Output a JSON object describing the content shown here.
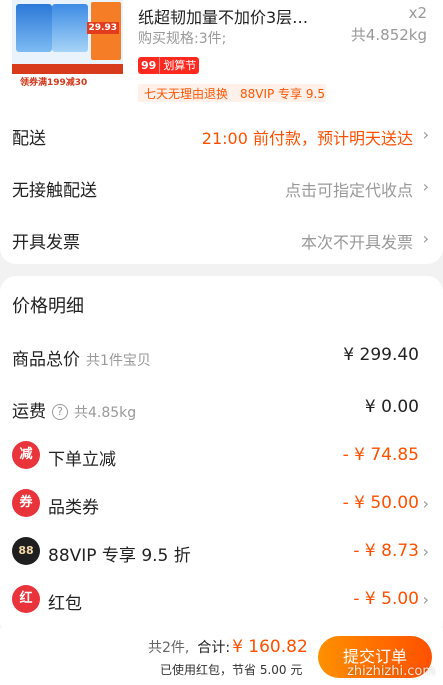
{
  "product": {
    "title": "纸超韧加量不加价3层…",
    "qty": "x2",
    "spec": "购买规格:3件;",
    "weight": "共4.852kg",
    "thumb_price": "29.93",
    "thumb_banner": "领券满199减30",
    "badge_a": "99",
    "badge_b": "划算节",
    "tags": [
      "七天无理由退换",
      "88VIP 专享 9.5 折"
    ]
  },
  "shipping": {
    "delivery": {
      "label": "配送",
      "value": "21:00 前付款，预计明天送达"
    },
    "contactless": {
      "label": "无接触配送",
      "value": "点击可指定代收点"
    },
    "invoice": {
      "label": "开具发票",
      "value": "本次不开具发票"
    }
  },
  "price_detail": {
    "title": "价格明细",
    "total": {
      "label": "商品总价",
      "sub": "共1件宝贝",
      "amount": "¥ 299.40"
    },
    "freight": {
      "label": "运费",
      "sub": "共4.85kg",
      "amount": "¥ 0.00"
    },
    "discount": {
      "icon": "减",
      "label": "下单立减",
      "amount": "- ¥ 74.85"
    },
    "coupon": {
      "icon": "券",
      "label": "品类券",
      "amount": "- ¥ 50.00"
    },
    "vip": {
      "icon": "88",
      "label": "88VIP 专享 9.5 折",
      "amount": "- ¥ 8.73"
    },
    "redpacket": {
      "icon": "红",
      "label": "红包",
      "amount": "- ¥ 5.00"
    }
  },
  "footer": {
    "count": "共2件,",
    "total_label": "合计:",
    "total_amount": "¥ 160.82",
    "saved": "已使用红包，节省 5.00 元",
    "submit": "提交订单"
  },
  "watermark": "zhizhizhi.com",
  "colors": {
    "accent": "#ff5000",
    "red": "#e8343a"
  }
}
